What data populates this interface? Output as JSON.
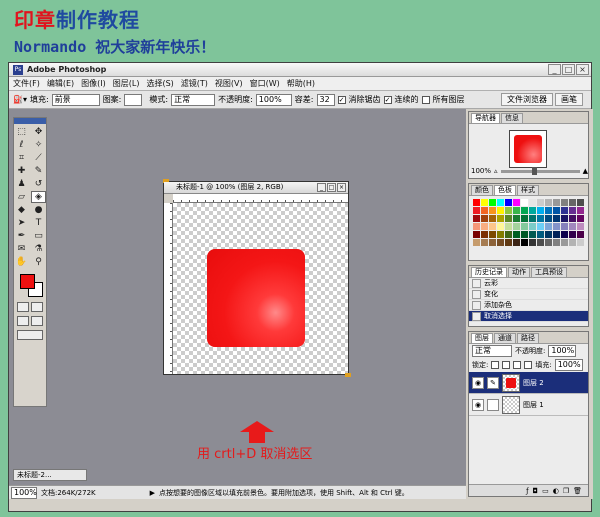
{
  "banner": {
    "title_red": "印章",
    "title_blue": "制作教程",
    "subtitle": "Normando 祝大家新年快乐！"
  },
  "window": {
    "title": "Adobe Photoshop",
    "controls": [
      "_",
      "□",
      "×"
    ]
  },
  "menu": [
    "文件(F)",
    "编辑(E)",
    "图像(I)",
    "图层(L)",
    "选择(S)",
    "滤镜(T)",
    "视图(V)",
    "窗口(W)",
    "帮助(H)"
  ],
  "options": {
    "fill_label": "填充:",
    "fill_value": "前景",
    "pattern_label": "图案:",
    "mode_label": "模式:",
    "mode_value": "正常",
    "opacity_label": "不透明度:",
    "opacity_value": "100%",
    "tolerance_label": "容差:",
    "tolerance_value": "32",
    "antialias_label": "消除锯齿",
    "contiguous_label": "连续的",
    "all_layers_label": "所有图层",
    "well_tabs": [
      "文件浏览器",
      "画笔"
    ]
  },
  "document": {
    "title": "未标题-1 @ 100% (图层 2, RGB)",
    "controls": [
      "_",
      "□",
      "×"
    ]
  },
  "caption": "用 crtl+D 取消选区",
  "minimized_doc": "未标题-2...",
  "status": {
    "zoom": "100%",
    "doc_size": "文档:264K/272K",
    "hint": "点按想要的图像区域以填充前景色。要用附加选项，使用 Shift、Alt 和 Ctrl 键。"
  },
  "navigator": {
    "tabs": [
      "导航器",
      "信息"
    ],
    "zoom": "100%"
  },
  "swatch_panel": {
    "tabs": [
      "颜色",
      "色板",
      "样式"
    ],
    "colors": [
      "#ff0000",
      "#ffff00",
      "#00ff00",
      "#00ffff",
      "#0000ff",
      "#ff00ff",
      "#ffffff",
      "#e6e6e6",
      "#cccccc",
      "#b3b3b3",
      "#999999",
      "#808080",
      "#666666",
      "#4d4d4d",
      "#ed1c24",
      "#f26522",
      "#f7941d",
      "#fff200",
      "#8dc63f",
      "#39b54a",
      "#00a651",
      "#00a99d",
      "#00aeef",
      "#0072bc",
      "#0054a6",
      "#2e3192",
      "#662d91",
      "#92278f",
      "#9e0b0f",
      "#a0410d",
      "#a36209",
      "#aba000",
      "#598527",
      "#197b30",
      "#007236",
      "#00746b",
      "#0076a3",
      "#004a80",
      "#003471",
      "#1b1464",
      "#440e62",
      "#630460",
      "#f69679",
      "#f9ad81",
      "#fdc68a",
      "#fff799",
      "#c4df9b",
      "#a3d39c",
      "#82ca9c",
      "#7accc8",
      "#6dcff6",
      "#7da7d9",
      "#8393ca",
      "#8781bd",
      "#a187be",
      "#bd8cbf",
      "#790000",
      "#7b2e00",
      "#7d4900",
      "#827b00",
      "#406618",
      "#005e20",
      "#005826",
      "#005952",
      "#005b7f",
      "#003663",
      "#002157",
      "#0d004c",
      "#32004b",
      "#4b0049",
      "#c69c6d",
      "#a67c52",
      "#8c6239",
      "#754c24",
      "#603913",
      "#3c2415",
      "#000000",
      "#333333",
      "#4d4d4d",
      "#666666",
      "#808080",
      "#999999",
      "#b3b3b3",
      "#cccccc"
    ]
  },
  "history": {
    "tabs": [
      "历史记录",
      "动作",
      "工具预设"
    ],
    "items": [
      "云彩",
      "变化",
      "添加杂色",
      "取消选择"
    ]
  },
  "layers": {
    "tabs": [
      "图层",
      "通道",
      "路径"
    ],
    "blend": "正常",
    "opacity_label": "不透明度:",
    "opacity": "100%",
    "lock_label": "锁定:",
    "fill_label": "填充:",
    "fill": "100%",
    "items": [
      "图层 2",
      "图层 1"
    ]
  }
}
